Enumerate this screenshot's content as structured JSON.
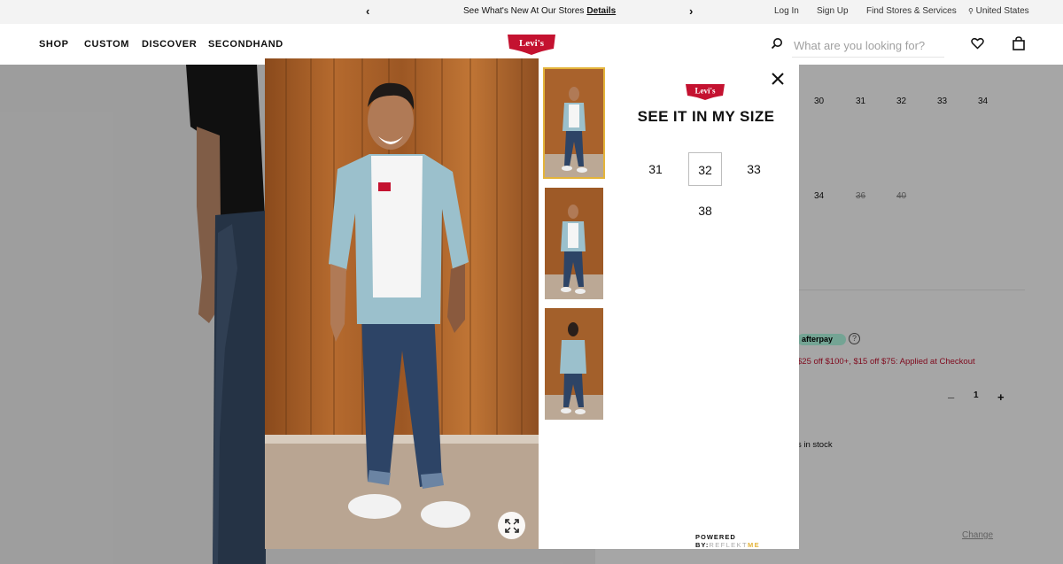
{
  "announcement": {
    "message": "See What's New At Our Stores",
    "details_link": "Details"
  },
  "utility_nav": {
    "login": "Log In",
    "signup": "Sign Up",
    "stores": "Find Stores & Services",
    "region": "United States"
  },
  "main_nav": {
    "items": [
      {
        "label": "SHOP"
      },
      {
        "label": "CUSTOM"
      },
      {
        "label": "DISCOVER"
      },
      {
        "label": "SECONDHAND"
      }
    ]
  },
  "brand": {
    "logo_text": "Levi's",
    "color": "#c41230"
  },
  "search": {
    "placeholder": "What are you looking for?"
  },
  "background_page": {
    "waist_sizes": [
      "30",
      "31",
      "32",
      "33",
      "34"
    ],
    "length_sizes": [
      {
        "label": "34",
        "available": true
      },
      {
        "label": "36",
        "available": false
      },
      {
        "label": "40",
        "available": false
      }
    ],
    "afterpay_label": "afterpay",
    "promo_text": "$25 off $100+, $15 off $75: Applied at Checkout",
    "quantity": {
      "minus": "–",
      "value": "1",
      "plus": "+"
    },
    "stock_text": "s in stock",
    "change_link": "Change"
  },
  "modal": {
    "title": "SEE IT IN MY SIZE",
    "sizes": [
      {
        "label": "31",
        "selected": false
      },
      {
        "label": "32",
        "selected": true
      },
      {
        "label": "33",
        "selected": false
      },
      {
        "label": "38",
        "selected": false
      }
    ],
    "thumbnails": [
      {
        "view": "front",
        "selected": true
      },
      {
        "view": "front",
        "selected": false
      },
      {
        "view": "back",
        "selected": false
      }
    ],
    "powered_by_label": "POWERED BY:",
    "powered_by_brand": "REFLEKT",
    "powered_by_brand_suffix": "ME",
    "accent": "#e4b43a"
  }
}
